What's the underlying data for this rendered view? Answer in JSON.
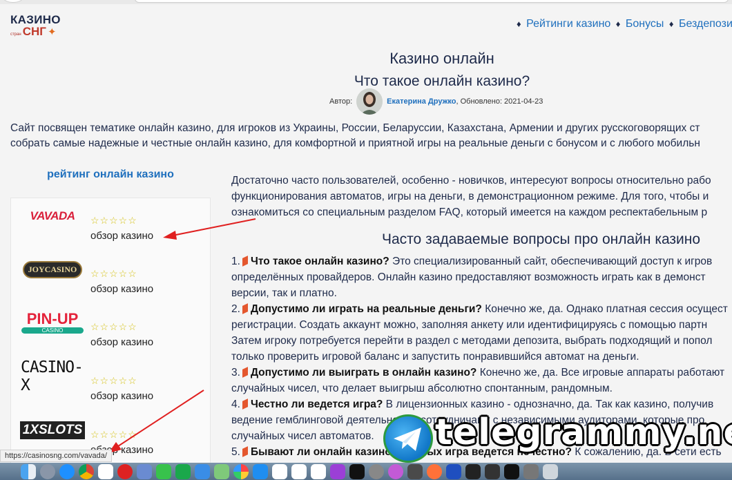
{
  "logo": {
    "line1": "КАЗИНО",
    "small": "стран",
    "line2": "СНГ",
    "star": "✦"
  },
  "nav": [
    {
      "label": "Рейтинги казино"
    },
    {
      "label": "Бонусы"
    },
    {
      "label": "Бездепозит"
    }
  ],
  "nav_sep": "♦",
  "title": "Казино онлайн",
  "subtitle": "Что такое онлайн казино?",
  "author": {
    "prefix": "Автор:",
    "name": "Екатерина Дружко",
    "updated": ", Обновлено: 2021-04-23"
  },
  "intro": [
    "Сайт посвящен тематике онлайн казино, для игроков из Украины, России, Беларуссии, Казахстана, Армении и других русскоговорящих ст",
    "собрать самые надежные и честные онлайн казино, для комфортной и приятной игры на реальные деньги с бонусом и с любого мобильн"
  ],
  "rating": {
    "title": "рейтинг онлайн казино",
    "stars": "☆☆☆☆☆",
    "review_label": "обзор казино",
    "casinos": [
      {
        "name": "VAVADA"
      },
      {
        "name": "JOYCASINO"
      },
      {
        "name": "PIN-UP",
        "sub": "CASINO"
      },
      {
        "name": "CASINO-X"
      },
      {
        "name": "1XSLOTS"
      }
    ]
  },
  "main_text": [
    "Достаточно часто пользователей, особенно - новичков, интересуют вопросы относительно рабо",
    "функционирования автоматов, игры на деньги, в демонстрационном режиме. Для того, чтобы и",
    "ознакомиться со специальным разделом FAQ, который имеется на каждом респектабельным р"
  ],
  "faq_title": "Часто задаваемые вопросы про онлайн казино",
  "faq": {
    "q1": {
      "num": "1.",
      "q": "Что такое онлайн казино?",
      "a": " Это специализированный сайт, обеспечивающий доступ к игров",
      "l2": "определённых провайдеров. Онлайн казино предоставляют возможность играть как в демонст",
      "l3": "версии, так и платно."
    },
    "q2": {
      "num": "2.",
      "q": "Допустимо ли играть на реальные деньги?",
      "a": " Конечно же, да. Однако платная сессия осущест",
      "l2": "регистрации. Создать аккаунт можно, заполняя анкету или идентифицируясь с помощью партн",
      "l3": "Затем игроку потребуется перейти в раздел с методами депозита, выбрать подходящий и попол",
      "l4": "только проверить игровой баланс и запустить понравившийся автомат на деньги."
    },
    "q3": {
      "num": "3.",
      "q": "Допустимо ли выиграть в онлайн казино?",
      "a": " Конечно же, да. Все игровые аппараты работают",
      "l2": "случайных чисел, что делает выигрыш абсолютно спонтанным, рандомным."
    },
    "q4": {
      "num": "4.",
      "q": "Честно ли ведется игра?",
      "a": " В лицензионных казино - однозначно, да. Так как казино, получив",
      "l2": "ведение гемблинговой деятельности, сотрудничают с независимыми аудиторами, которые про",
      "l3": "случайных чисел автоматов."
    },
    "q5": {
      "num": "5.",
      "q": "Бывают ли онлайн казино, которых игра ведется нечестно?",
      "a": " К сожалению, да. В сети есть"
    }
  },
  "watermark": "telegrammy.net",
  "status_url": "https://casinosng.com/vavada/"
}
